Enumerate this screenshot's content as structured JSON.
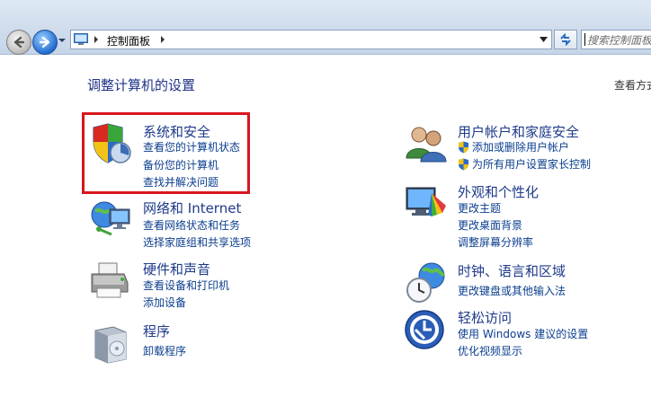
{
  "address_bar": {
    "path": "控制面板",
    "search_placeholder": "搜索控制面板"
  },
  "header": {
    "title": "调整计算机的设置",
    "view_by": "查看方式"
  },
  "categories": [
    {
      "title": "系统和安全",
      "links": [
        "查看您的计算机状态",
        "备份您的计算机",
        "查找并解决问题"
      ]
    },
    {
      "title": "网络和 Internet",
      "links": [
        "查看网络状态和任务",
        "选择家庭组和共享选项"
      ]
    },
    {
      "title": "硬件和声音",
      "links": [
        "查看设备和打印机",
        "添加设备"
      ]
    },
    {
      "title": "程序",
      "links": [
        "卸载程序"
      ]
    },
    {
      "title": "用户帐户和家庭安全",
      "links": [
        "添加或删除用户帐户",
        "为所有用户设置家长控制"
      ]
    },
    {
      "title": "外观和个性化",
      "links": [
        "更改主题",
        "更改桌面背景",
        "调整屏幕分辨率"
      ]
    },
    {
      "title": "时钟、语言和区域",
      "links": [
        "更改键盘或其他输入法"
      ]
    },
    {
      "title": "轻松访问",
      "links": [
        "使用 Windows 建议的设置",
        "优化视频显示"
      ]
    }
  ],
  "colors": {
    "highlight_border": "#d8161d",
    "link": "#0b3e8e",
    "title": "#1e3a8a"
  }
}
